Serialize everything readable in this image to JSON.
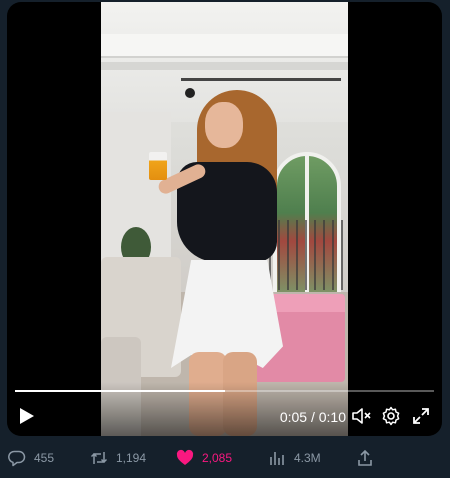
{
  "video": {
    "current_time": "0:05",
    "duration": "0:10",
    "time_display": "0:05 / 0:10",
    "progress_fraction": 0.5
  },
  "controls": {
    "play_icon": "play-icon",
    "mute_icon": "volume-muted-icon",
    "settings_icon": "gear-icon",
    "fullscreen_icon": "fullscreen-icon"
  },
  "actions": {
    "replies": "455",
    "retweets": "1,194",
    "likes": "2,085",
    "views": "4.3M"
  },
  "colors": {
    "background": "#15202b",
    "like_accent": "#f91880",
    "muted_text": "#8b98a5"
  }
}
